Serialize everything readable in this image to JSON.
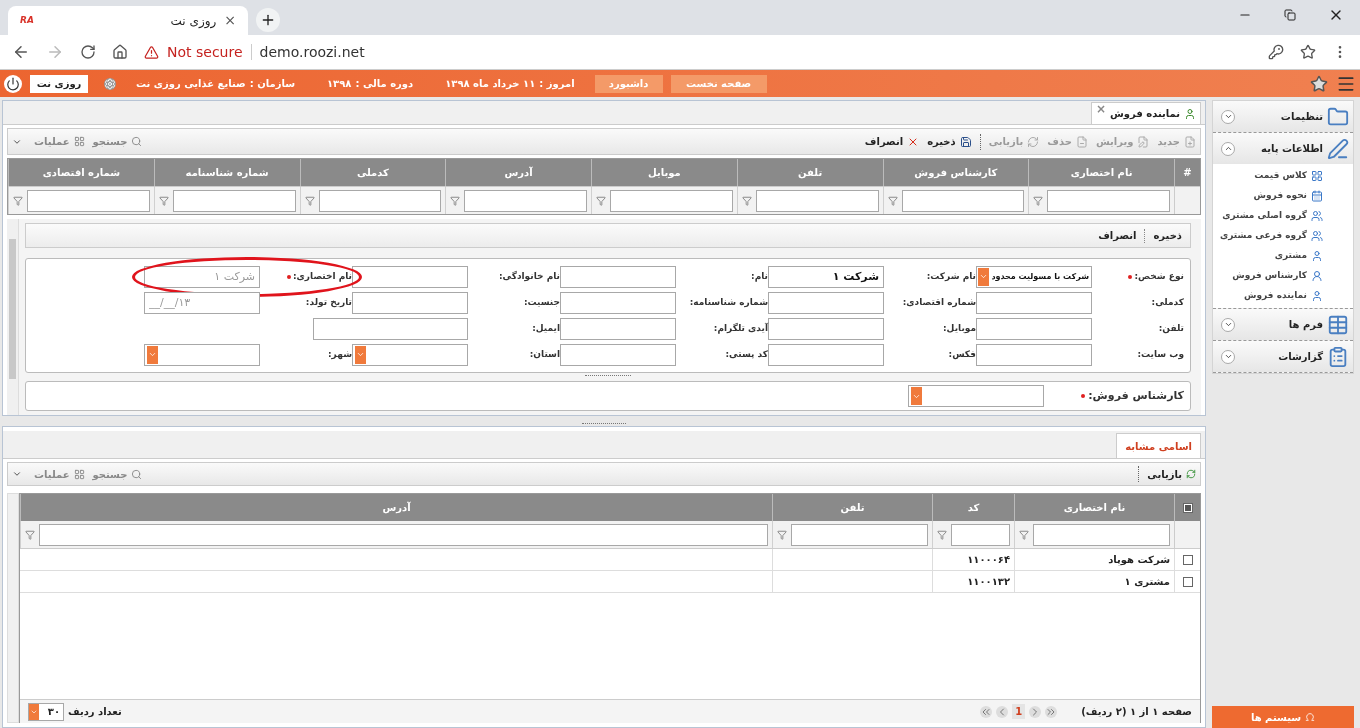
{
  "browser": {
    "favicon": "RA",
    "tab_title": "روزی نت",
    "tab_close": "×",
    "security": "Not secure",
    "url": "demo.roozi.net"
  },
  "topbar": {
    "user": "روزی نت",
    "org_label": "سازمان :",
    "org": "صنایع غذایی روزی نت",
    "fiscal_label": "دوره مالی :",
    "fiscal": "۱۳۹۸",
    "today_label": "امروز :",
    "today": "۱۱ خرداد ماه ۱۳۹۸",
    "buttons": [
      "صفحه نخست",
      "داشبورد"
    ]
  },
  "form_tab": {
    "title": "نماینده فروش",
    "close": "×"
  },
  "toolbar": {
    "actions": [
      {
        "label": "جدید",
        "disabled": true
      },
      {
        "label": "ویرایش",
        "disabled": true
      },
      {
        "label": "حذف",
        "disabled": true
      },
      {
        "label": "بازیابی",
        "disabled": true
      },
      {
        "label": "ذخیره",
        "disabled": false
      },
      {
        "label": "انصراف",
        "disabled": false
      }
    ],
    "search": "جستجو",
    "operations": "عملیات"
  },
  "grid": {
    "columns": [
      "#",
      "نام اختصاری",
      "کارشناس فروش",
      "تلفن",
      "موبایل",
      "آدرس",
      "کدملی",
      "شماره شناسنامه",
      "شماره اقتصادی"
    ]
  },
  "editor": {
    "actions": [
      "ذخیره",
      "انصراف"
    ],
    "rows": [
      [
        {
          "label": "نوع شخص:",
          "required": true,
          "kind": "select",
          "value": "شرکت با مسولیت محدود"
        },
        {
          "label": "نام شرکت:",
          "kind": "text",
          "value": "شرکت ۱"
        },
        {
          "label": "نام:",
          "kind": "text"
        },
        {
          "label": "نام خانوادگی:",
          "kind": "text"
        },
        {
          "label": "نام اختصاری:",
          "required": true,
          "kind": "text",
          "placeholder": "شرکت ۱",
          "highlighted": true
        }
      ],
      [
        {
          "label": "کدملی:",
          "kind": "text"
        },
        {
          "label": "شماره اقتصادی:",
          "kind": "text"
        },
        {
          "label": "شماره شناسنامه:",
          "kind": "text"
        },
        {
          "label": "جنسیت:",
          "kind": "readonly"
        },
        {
          "label": "تاریخ تولد:",
          "kind": "date",
          "placeholder": "__/__/۱۳"
        }
      ],
      [
        {
          "label": "تلفن:",
          "kind": "text"
        },
        {
          "label": "موبایل:",
          "kind": "text"
        },
        {
          "label": "آیدی تلگرام:",
          "kind": "text"
        },
        {
          "label": "ایمیل:",
          "kind": "wide"
        }
      ],
      [
        {
          "label": "وب سایت:",
          "kind": "text"
        },
        {
          "label": "فکس:",
          "kind": "text"
        },
        {
          "label": "کد پستی:",
          "kind": "text"
        },
        {
          "label": "استان:",
          "kind": "select"
        },
        {
          "label": "شهر:",
          "kind": "select"
        }
      ]
    ],
    "expert": {
      "label": "کارشناس فروش:",
      "required": true
    }
  },
  "similar": {
    "tab": "اسامی مشابه",
    "refresh": "بازیابی",
    "search": "جستجو",
    "operations": "عملیات",
    "select_all_checked": true,
    "columns": [
      "نام اختصاری",
      "کد",
      "تلفن",
      "آدرس"
    ],
    "rows": [
      {
        "checked": false,
        "name": "شرکت هوپاد",
        "code": "۱۱۰۰۰۶۴"
      },
      {
        "checked": false,
        "name": "مشتری ۱",
        "code": "۱۱۰۰۱۳۲"
      }
    ],
    "pager": {
      "info": "صفحه ۱ از ۱ (۲ ردیف)",
      "page": "1",
      "page_size": "۳۰",
      "page_size_label": "تعداد ردیف"
    }
  },
  "sidebar": {
    "sections": [
      {
        "title": "تنظیمات",
        "expanded": false
      },
      {
        "title": "اطلاعات پایه",
        "expanded": true,
        "items": [
          "کلاس قیمت",
          "نحوه فروش",
          "گروه اصلی مشتری",
          "گروه فرعی مشتری",
          "مشتری",
          "کارشناس فروش",
          "نماینده فروش"
        ]
      },
      {
        "title": "فرم ها",
        "expanded": false
      },
      {
        "title": "گزارشات",
        "expanded": false
      }
    ],
    "systems": "سیستم ها"
  }
}
